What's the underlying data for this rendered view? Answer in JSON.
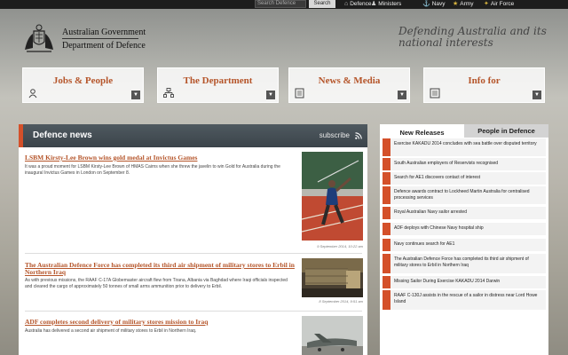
{
  "topbar": {
    "search_placeholder": "Search Defence",
    "search_button": "Search",
    "links": [
      {
        "label": "Defence",
        "icon": "home-icon"
      },
      {
        "label": "Ministers",
        "icon": "people-icon"
      },
      {
        "label": "Navy",
        "icon": "anchor-icon"
      },
      {
        "label": "Army",
        "icon": "army-badge-icon"
      },
      {
        "label": "Air Force",
        "icon": "wings-icon"
      }
    ]
  },
  "header": {
    "org_line1": "Australian Government",
    "org_line2": "Department of Defence",
    "tagline": "Defending Australia and its national interests"
  },
  "tiles": [
    {
      "label": "Jobs & People",
      "icon": "people-icon"
    },
    {
      "label": "The Department",
      "icon": "org-chart-icon"
    },
    {
      "label": "News & Media",
      "icon": "newspaper-icon"
    },
    {
      "label": "Info for",
      "icon": "list-icon"
    }
  ],
  "news": {
    "title": "Defence news",
    "subscribe": "subscribe",
    "articles": [
      {
        "title": "LSBM Kirsty-Lee Brown wins gold medal at Invictus Games",
        "text": "It was a proud moment for LSBM Kirsty-Lee Brown of HMAS Cairns when she threw the javelin to win Gold for Australia during the inaugural Invictus Games in London on September 8.",
        "date": "9 September 2014, 10:22 am"
      },
      {
        "title": "The Australian Defence Force has completed its third air shipment of military stores to Erbil in Northern Iraq",
        "text": "As with previous missions, the RAAF C-17A Globemaster aircraft flew from Tirana, Albania via Baghdad where Iraqi officials inspected and cleared the cargo of approximately 50 tonnes of small arms ammunition prior to delivery to Erbil.",
        "date": "8 September 2014, 9:51 am"
      },
      {
        "title": "ADF completes second delivery of military stores mission to Iraq",
        "text": "Australia has delivered a second air shipment of military stores to Erbil in Northern Iraq.",
        "date": ""
      }
    ]
  },
  "sidebar": {
    "tabs": [
      "New Releases",
      "People in Defence"
    ],
    "items": [
      "Exercise KAKADU 2014 concludes with sea battle over disputed territory",
      "South Australian employers of Reservists recognised",
      "Search for AE1 discovers contact of interest",
      "Defence awards contract to Lockheed Martin Australia for centralised processing services",
      "Royal Australian Navy sailor arrested",
      "ADF deploys with Chinese Navy hospital ship",
      "Navy continues search for AE1",
      "The Australian Defence Force has completed its third air shipment of military stores to Erbil in Northern Iraq",
      "Missing Sailor During Exercise KAKADU 2014 Darwin",
      "RAAF C-130J assists in the rescue of a sailor in distress near Lord Howe Island"
    ]
  },
  "colors": {
    "accent": "#d4502a",
    "link": "#b5552a",
    "header_bar": "#3b444a"
  }
}
